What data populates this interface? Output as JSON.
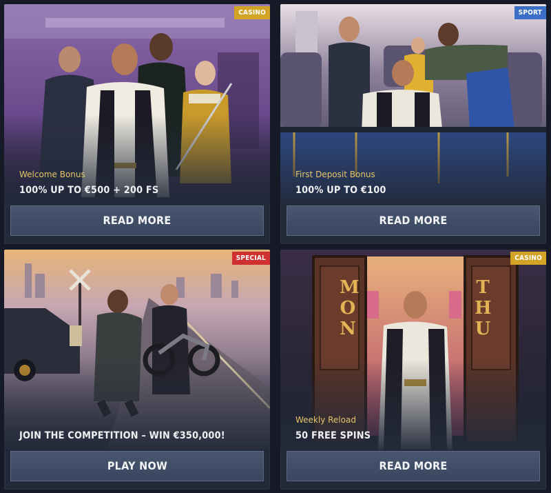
{
  "cards": [
    {
      "badge": "CASINO",
      "label": "Welcome Bonus",
      "headline": "100% UP TO €500 + 200 FS",
      "button": "READ MORE"
    },
    {
      "badge": "SPORT",
      "label": "First Deposit Bonus",
      "headline": "100% UP TO €100",
      "button": "READ MORE"
    },
    {
      "badge": "SPECIAL",
      "label": "",
      "headline": "JOIN THE COMPETITION – WIN €350,000!",
      "button": "PLAY NOW"
    },
    {
      "badge": "CASINO",
      "label": "Weekly Reload",
      "headline": "50 FREE SPINS",
      "button": "READ MORE"
    }
  ],
  "door_letters": {
    "left": "MON",
    "right": "THU"
  },
  "colors": {
    "casino_badge": "#d3a326",
    "sport_badge": "#3b6fc5",
    "special_badge": "#d03030",
    "label_gold": "#e6c56a",
    "button_bg": "#3f4b64"
  }
}
